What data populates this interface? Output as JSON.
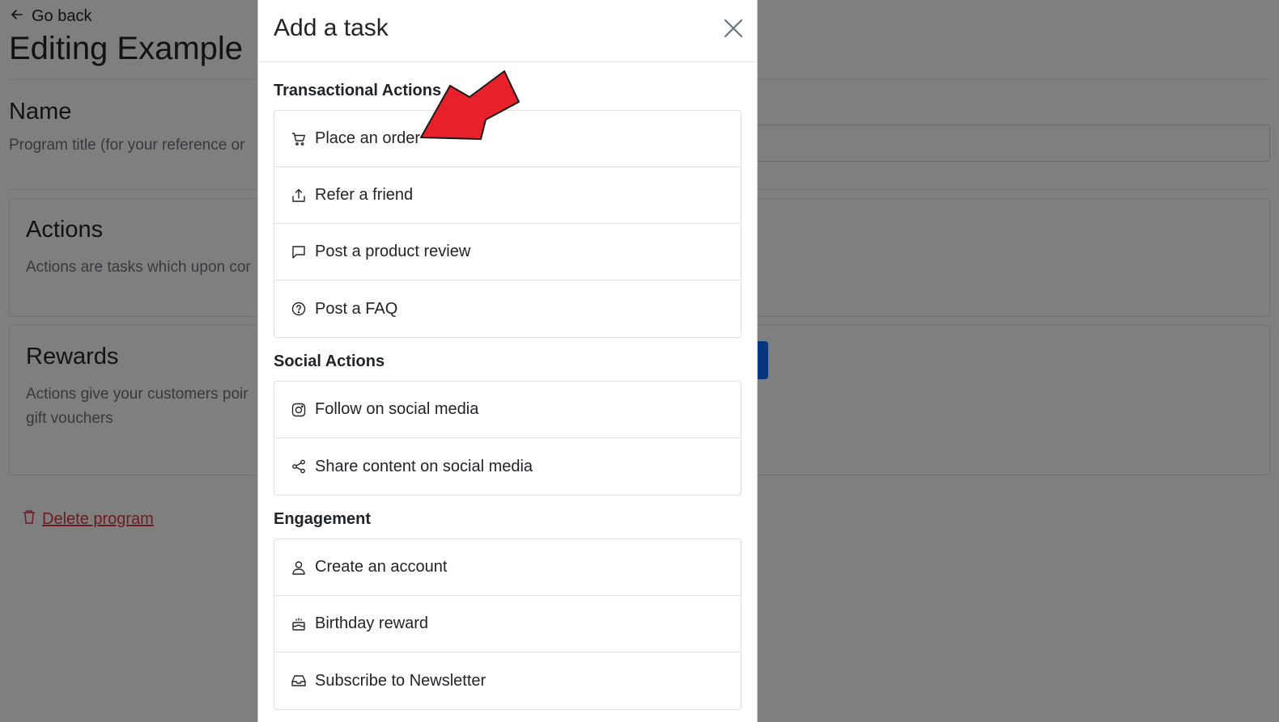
{
  "background": {
    "go_back": "Go back",
    "title": "Editing Example",
    "name_heading": "Name",
    "name_help": "Program title (for your reference or",
    "actions_heading": "Actions",
    "actions_desc": "Actions are tasks which upon cor",
    "rewards_heading": "Rewards",
    "rewards_desc": "Actions give your customers poir gift vouchers",
    "delete_label": "Delete program"
  },
  "modal": {
    "title": "Add a task",
    "sections": [
      {
        "title": "Transactional Actions",
        "items": [
          {
            "label": "Place an order",
            "icon": "cart-icon"
          },
          {
            "label": "Refer a friend",
            "icon": "share-upload-icon"
          },
          {
            "label": "Post a product review",
            "icon": "chat-bubble-icon"
          },
          {
            "label": "Post a FAQ",
            "icon": "question-circle-icon"
          }
        ]
      },
      {
        "title": "Social Actions",
        "items": [
          {
            "label": "Follow on social media",
            "icon": "instagram-icon"
          },
          {
            "label": "Share content on social media",
            "icon": "share-nodes-icon"
          }
        ]
      },
      {
        "title": "Engagement",
        "items": [
          {
            "label": "Create an account",
            "icon": "person-icon"
          },
          {
            "label": "Birthday reward",
            "icon": "cake-icon"
          },
          {
            "label": "Subscribe to Newsletter",
            "icon": "inbox-icon"
          }
        ]
      }
    ]
  },
  "colors": {
    "accent_blue": "#0d6efd",
    "danger_red": "#dc3545",
    "annotation_arrow": "#e8202a"
  }
}
